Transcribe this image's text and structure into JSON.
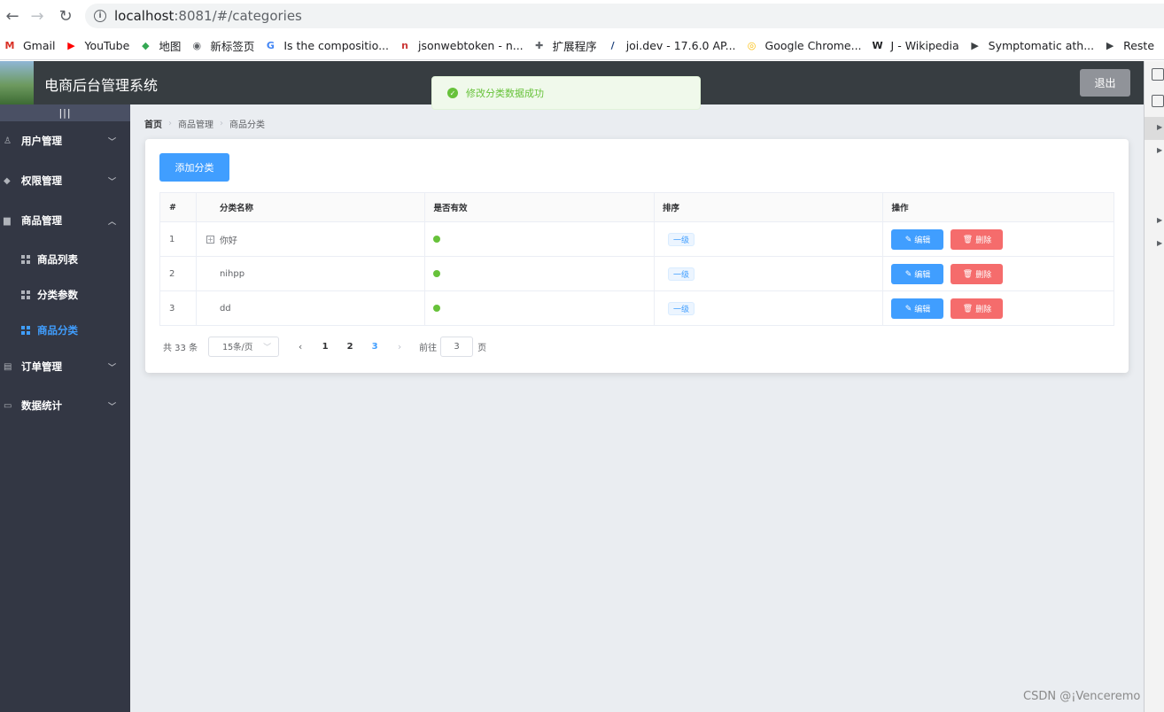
{
  "browser": {
    "url_host": "localhost",
    "url_path": ":8081/#/categories",
    "bookmarks": [
      {
        "label": "Gmail",
        "icon": "gmail-icon",
        "glyph": "M",
        "color": "#d93025"
      },
      {
        "label": "YouTube",
        "icon": "youtube-icon",
        "glyph": "▶",
        "color": "#ff0000"
      },
      {
        "label": "地图",
        "icon": "maps-icon",
        "glyph": "◆",
        "color": "#34a853"
      },
      {
        "label": "新标签页",
        "icon": "globe-icon",
        "glyph": "◉",
        "color": "#5f6368"
      },
      {
        "label": "Is the compositio...",
        "icon": "google-icon",
        "glyph": "G",
        "color": "#4285f4"
      },
      {
        "label": "jsonwebtoken - n...",
        "icon": "npm-icon",
        "glyph": "n",
        "color": "#cb3837"
      },
      {
        "label": "扩展程序",
        "icon": "puzzle-icon",
        "glyph": "✚",
        "color": "#5f6368"
      },
      {
        "label": "joi.dev - 17.6.0 AP...",
        "icon": "joi-icon",
        "glyph": "/",
        "color": "#1a3f7a"
      },
      {
        "label": "Google Chrome...",
        "icon": "chrome-icon",
        "glyph": "◎",
        "color": "#fbbc04"
      },
      {
        "label": "J - Wikipedia",
        "icon": "wikipedia-icon",
        "glyph": "W",
        "color": "#202124"
      },
      {
        "label": "Symptomatic ath...",
        "icon": "bookmark-icon",
        "glyph": "▶",
        "color": "#3c4043"
      },
      {
        "label": "Reste",
        "icon": "bookmark-icon",
        "glyph": "▶",
        "color": "#3c4043"
      }
    ]
  },
  "header": {
    "title": "电商后台管理系统",
    "logout": "退出"
  },
  "toast": {
    "message": "修改分类数据成功"
  },
  "sidebar": {
    "toggle": "|||",
    "items": [
      {
        "label": "用户管理",
        "icon": "user-icon"
      },
      {
        "label": "权限管理",
        "icon": "cube-icon"
      },
      {
        "label": "商品管理",
        "icon": "box-icon"
      },
      {
        "label": "订单管理",
        "icon": "clipboard-icon"
      },
      {
        "label": "数据统计",
        "icon": "monitor-icon"
      }
    ],
    "sub_items": [
      {
        "label": "商品列表"
      },
      {
        "label": "分类参数"
      },
      {
        "label": "商品分类"
      }
    ]
  },
  "breadcrumb": [
    "首页",
    "商品管理",
    "商品分类"
  ],
  "add_button": "添加分类",
  "table": {
    "headers": [
      "#",
      "分类名称",
      "是否有效",
      "排序",
      "操作"
    ],
    "rows": [
      {
        "index": "1",
        "name": "你好",
        "level": "一级",
        "expandable": true
      },
      {
        "index": "2",
        "name": "nihpp",
        "level": "一级",
        "expandable": false
      },
      {
        "index": "3",
        "name": "dd",
        "level": "一级",
        "expandable": false
      }
    ],
    "edit_label": "编辑",
    "delete_label": "删除"
  },
  "pagination": {
    "total": "共 33 条",
    "page_size": "15条/页",
    "pages": [
      "1",
      "2",
      "3"
    ],
    "current": "3",
    "goto_prefix": "前往",
    "goto_value": "3",
    "goto_suffix": "页"
  },
  "watermark": "CSDN @¡Venceremo"
}
